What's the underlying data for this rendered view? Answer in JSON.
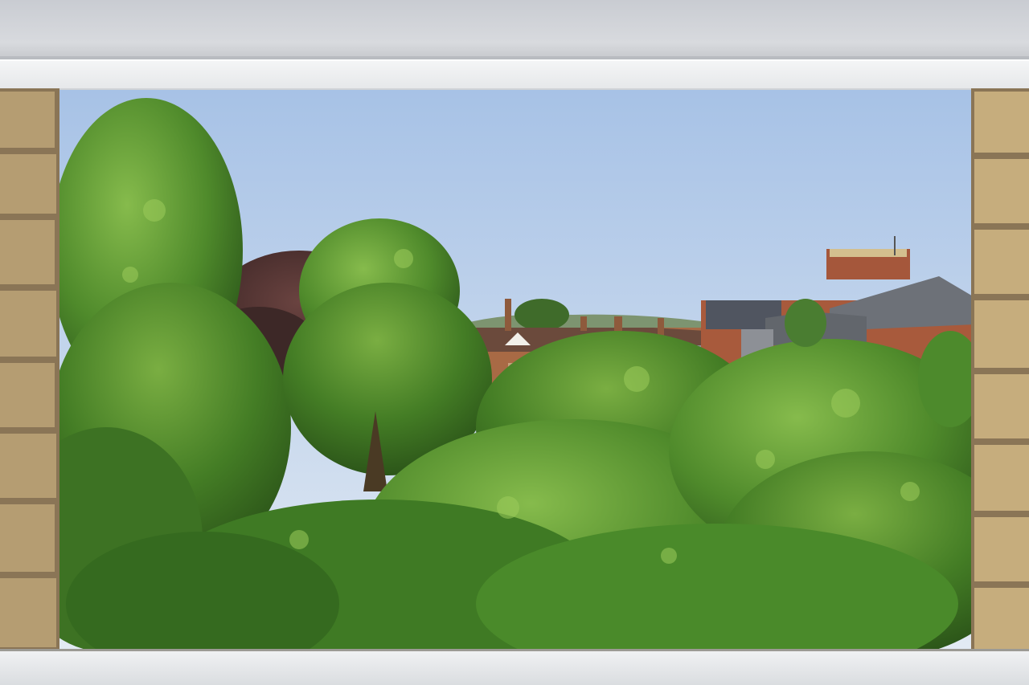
{
  "scene": {
    "subject": "window-view-over-gardens-and-rooftops",
    "colors": {
      "sky_top": "#a9c3e6",
      "sky_bottom": "#dfe8f2",
      "foliage_dark": "#2f5a1c",
      "foliage_mid": "#4f8a2b",
      "foliage_light": "#7fb447",
      "copper_beech": "#4a2f2e",
      "brick_red": "#a0553a",
      "roof_slate": "#5b5f66",
      "window_frame": "#eef0f2",
      "stone_brick": "#b79f74"
    }
  }
}
